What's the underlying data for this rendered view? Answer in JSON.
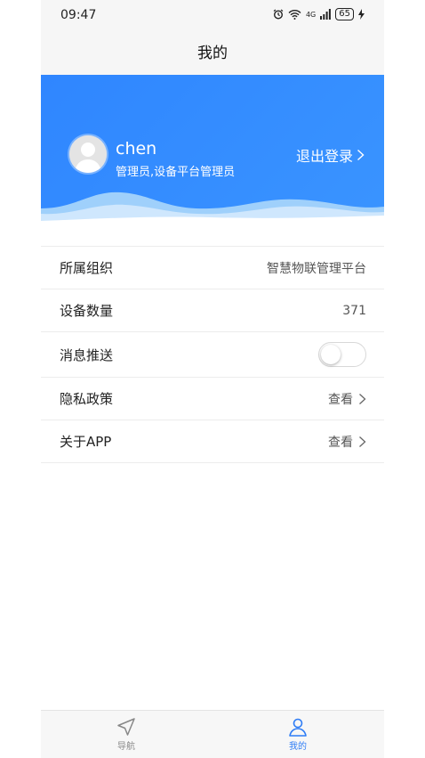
{
  "status_bar": {
    "time": "09:47",
    "signal_label": "4G",
    "battery": "65"
  },
  "nav": {
    "title": "我的"
  },
  "profile": {
    "username": "chen",
    "role": "管理员,设备平台管理员",
    "logout_label": "退出登录"
  },
  "settings": {
    "org_label": "所属组织",
    "org_value": "智慧物联管理平台",
    "device_count_label": "设备数量",
    "device_count_value": "371",
    "push_label": "消息推送",
    "push_enabled": false,
    "privacy_label": "隐私政策",
    "privacy_action": "查看",
    "about_label": "关于APP",
    "about_action": "查看"
  },
  "tabs": [
    {
      "label": "导航",
      "icon": "navigation-icon",
      "active": false
    },
    {
      "label": "我的",
      "icon": "user-icon",
      "active": true
    }
  ],
  "colors": {
    "accent": "#2f86ff",
    "tab_active": "#2f7df5",
    "tab_inactive": "#888888"
  }
}
